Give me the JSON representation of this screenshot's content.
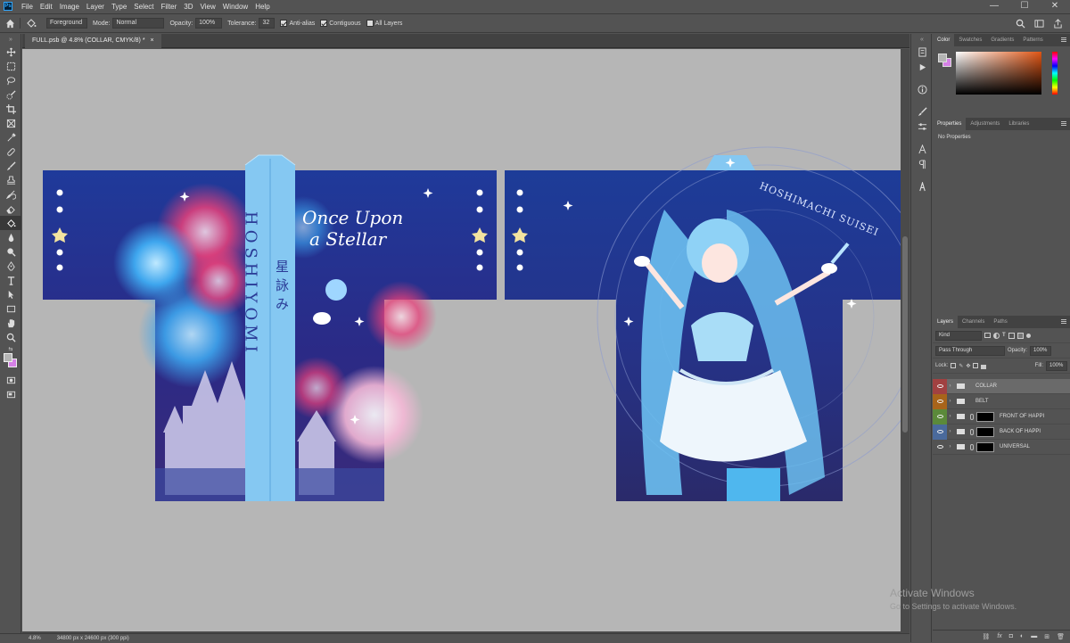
{
  "app": {
    "logo": "Ps",
    "name": "Adobe Photoshop"
  },
  "menu": [
    "File",
    "Edit",
    "Image",
    "Layer",
    "Type",
    "Select",
    "Filter",
    "3D",
    "View",
    "Window",
    "Help"
  ],
  "window_controls": {
    "minimize": "—",
    "maximize": "☐",
    "close": "✕"
  },
  "options": {
    "source_value": "Foreground",
    "mode_label": "Mode:",
    "mode_value": "Normal",
    "opacity_label": "Opacity:",
    "opacity_value": "100%",
    "tolerance_label": "Tolerance:",
    "tolerance_value": "32",
    "antialias_label": "Anti-alias",
    "contiguous_label": "Contiguous",
    "all_layers_label": "All Layers",
    "antialias_checked": true,
    "contiguous_checked": true,
    "all_layers_checked": false
  },
  "document": {
    "tab_title": "FULL.psb @ 4.8% (COLLAR, CMYK/8) *",
    "close_glyph": "×"
  },
  "artwork": {
    "front_title_line1": "Once Upon",
    "front_title_line2": "a Stellar",
    "front_name_latin": "HOSHIYOMI",
    "front_name_kanji": "星詠み",
    "back_arc_text": "HOSHIMACHI SUISEI",
    "colors": {
      "sky": "#1c2b7a",
      "collar": "#7ec6f2",
      "accent": "#e8407a"
    }
  },
  "status": {
    "zoom": "4.8%",
    "doc_size": "34800 px x 24600 px (300 ppi)"
  },
  "panels": {
    "color_tabs": [
      "Color",
      "Swatches",
      "Gradients",
      "Patterns"
    ],
    "properties_tabs": [
      "Properties",
      "Adjustments",
      "Libraries"
    ],
    "no_properties": "No Properties",
    "fg_color": "#b4b4b4",
    "bg_color": "#d580e6"
  },
  "layers_panel": {
    "tabs": [
      "Layers",
      "Channels",
      "Paths"
    ],
    "kind_filter": "Kind",
    "blend_mode": "Pass Through",
    "opacity_label": "Opacity:",
    "opacity_value": "100%",
    "lock_label": "Lock:",
    "fill_label": "Fill:",
    "fill_value": "100%",
    "layers": [
      {
        "name": "COLLAR",
        "label_color": "#a14141",
        "selected": true,
        "mask": false
      },
      {
        "name": "BELT",
        "label_color": "#a8641a",
        "selected": false,
        "mask": false
      },
      {
        "name": "FRONT OF HAPPI",
        "label_color": "#5b8a3a",
        "selected": false,
        "mask": true
      },
      {
        "name": "BACK OF HAPPI",
        "label_color": "#4a6a9c",
        "selected": false,
        "mask": true
      },
      {
        "name": "UNIVERSAL",
        "label_color": "",
        "selected": false,
        "mask": true
      }
    ],
    "footer_icons": [
      "link-icon",
      "fx-icon",
      "mask-icon",
      "adjustment-icon",
      "group-icon",
      "new-layer-icon",
      "trash-icon"
    ]
  },
  "watermark": {
    "line1": "Activate Windows",
    "line2": "Go to Settings to activate Windows."
  }
}
